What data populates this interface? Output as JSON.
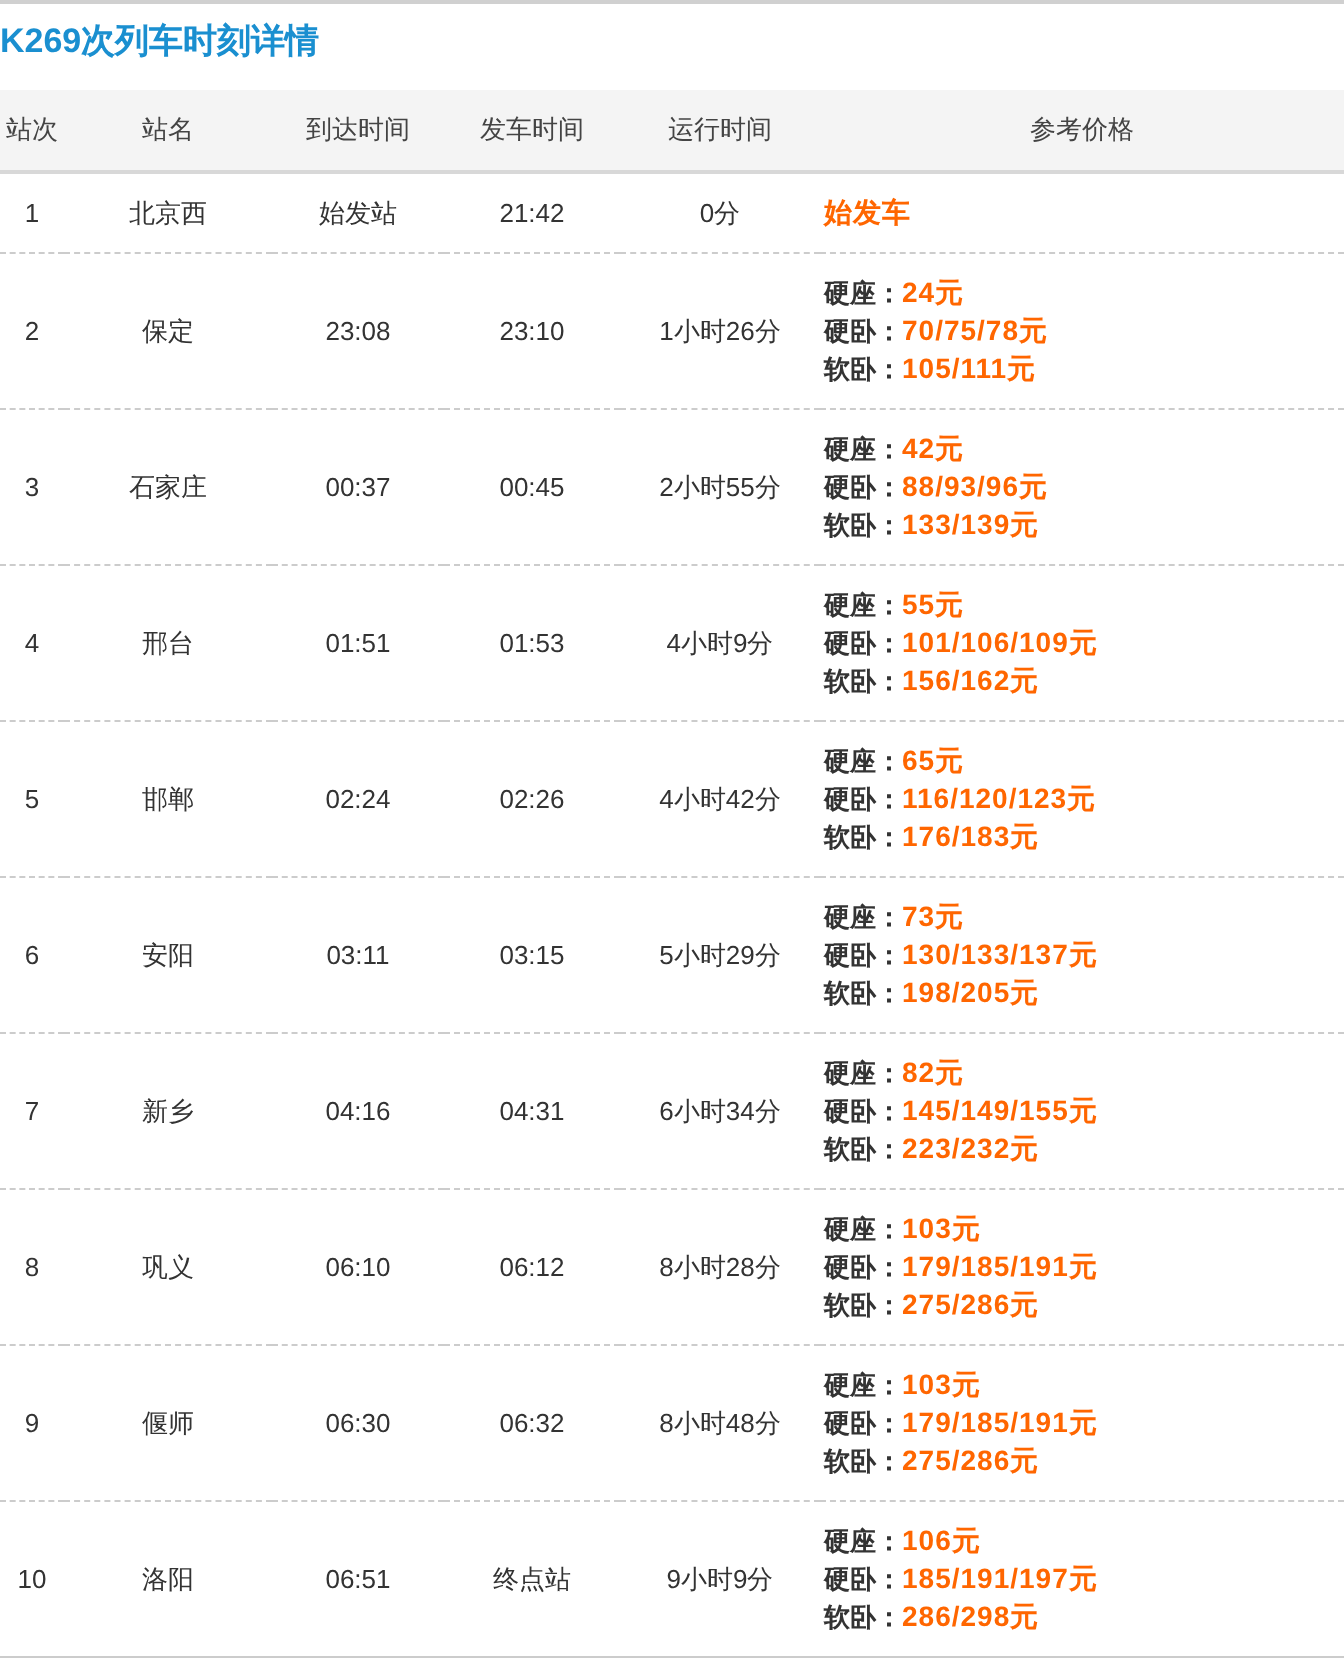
{
  "title": "K269次列车时刻详情",
  "columns": [
    "站次",
    "站名",
    "到达时间",
    "发车时间",
    "运行时间",
    "参考价格"
  ],
  "rows": [
    {
      "no": "1",
      "station": "北京西",
      "arrive": "始发站",
      "depart": "21:42",
      "duration": "0分",
      "price": {
        "kind": "note",
        "text": "始发车"
      }
    },
    {
      "no": "2",
      "station": "保定",
      "arrive": "23:08",
      "depart": "23:10",
      "duration": "1小时26分",
      "price": {
        "kind": "fares",
        "fares": [
          {
            "label": "硬座：",
            "value": "24元"
          },
          {
            "label": "硬卧：",
            "value": "70/75/78元"
          },
          {
            "label": "软卧：",
            "value": "105/111元"
          }
        ]
      }
    },
    {
      "no": "3",
      "station": "石家庄",
      "arrive": "00:37",
      "depart": "00:45",
      "duration": "2小时55分",
      "price": {
        "kind": "fares",
        "fares": [
          {
            "label": "硬座：",
            "value": "42元"
          },
          {
            "label": "硬卧：",
            "value": "88/93/96元"
          },
          {
            "label": "软卧：",
            "value": "133/139元"
          }
        ]
      }
    },
    {
      "no": "4",
      "station": "邢台",
      "arrive": "01:51",
      "depart": "01:53",
      "duration": "4小时9分",
      "price": {
        "kind": "fares",
        "fares": [
          {
            "label": "硬座：",
            "value": "55元"
          },
          {
            "label": "硬卧：",
            "value": "101/106/109元"
          },
          {
            "label": "软卧：",
            "value": "156/162元"
          }
        ]
      }
    },
    {
      "no": "5",
      "station": "邯郸",
      "arrive": "02:24",
      "depart": "02:26",
      "duration": "4小时42分",
      "price": {
        "kind": "fares",
        "fares": [
          {
            "label": "硬座：",
            "value": "65元"
          },
          {
            "label": "硬卧：",
            "value": "116/120/123元"
          },
          {
            "label": "软卧：",
            "value": "176/183元"
          }
        ]
      }
    },
    {
      "no": "6",
      "station": "安阳",
      "arrive": "03:11",
      "depart": "03:15",
      "duration": "5小时29分",
      "price": {
        "kind": "fares",
        "fares": [
          {
            "label": "硬座：",
            "value": "73元"
          },
          {
            "label": "硬卧：",
            "value": "130/133/137元"
          },
          {
            "label": "软卧：",
            "value": "198/205元"
          }
        ]
      }
    },
    {
      "no": "7",
      "station": "新乡",
      "arrive": "04:16",
      "depart": "04:31",
      "duration": "6小时34分",
      "price": {
        "kind": "fares",
        "fares": [
          {
            "label": "硬座：",
            "value": "82元"
          },
          {
            "label": "硬卧：",
            "value": "145/149/155元"
          },
          {
            "label": "软卧：",
            "value": "223/232元"
          }
        ]
      }
    },
    {
      "no": "8",
      "station": "巩义",
      "arrive": "06:10",
      "depart": "06:12",
      "duration": "8小时28分",
      "price": {
        "kind": "fares",
        "fares": [
          {
            "label": "硬座：",
            "value": "103元"
          },
          {
            "label": "硬卧：",
            "value": "179/185/191元"
          },
          {
            "label": "软卧：",
            "value": "275/286元"
          }
        ]
      }
    },
    {
      "no": "9",
      "station": "偃师",
      "arrive": "06:30",
      "depart": "06:32",
      "duration": "8小时48分",
      "price": {
        "kind": "fares",
        "fares": [
          {
            "label": "硬座：",
            "value": "103元"
          },
          {
            "label": "硬卧：",
            "value": "179/185/191元"
          },
          {
            "label": "软卧：",
            "value": "275/286元"
          }
        ]
      }
    },
    {
      "no": "10",
      "station": "洛阳",
      "arrive": "06:51",
      "depart": "终点站",
      "duration": "9小时9分",
      "price": {
        "kind": "fares",
        "fares": [
          {
            "label": "硬座：",
            "value": "106元"
          },
          {
            "label": "硬卧：",
            "value": "185/191/197元"
          },
          {
            "label": "软卧：",
            "value": "286/298元"
          }
        ]
      }
    }
  ]
}
